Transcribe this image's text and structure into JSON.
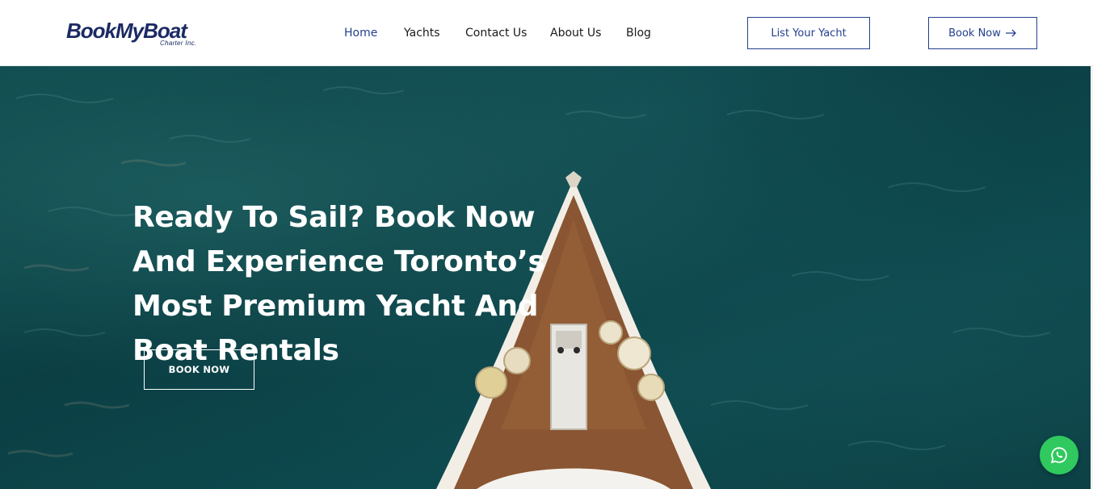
{
  "brand": {
    "name_part1": "BookMy",
    "name_part2": "Boat",
    "tagline": "Charter Inc.",
    "color": "#1b2a63"
  },
  "nav": {
    "items": [
      {
        "label": "Home",
        "active": true
      },
      {
        "label": "Yachts",
        "active": false
      },
      {
        "label": "Contact Us",
        "active": false
      },
      {
        "label": "About Us",
        "active": false
      },
      {
        "label": "Blog",
        "active": false
      }
    ],
    "active_color": "#24408e"
  },
  "header_buttons": {
    "list_yacht": "List Your Yacht",
    "book_now": "Book Now",
    "book_now_icon": "arrow-right-icon"
  },
  "hero": {
    "title_lines": [
      "Ready To Sail? Book Now",
      "And Experience Toronto’s",
      "Most Premium Yacht And",
      "Boat Rentals"
    ],
    "cta": "BOOK NOW",
    "background": "aerial-ocean-with-yacht-bow"
  },
  "floating": {
    "whatsapp_icon": "whatsapp-icon",
    "color": "#2fc95f"
  }
}
